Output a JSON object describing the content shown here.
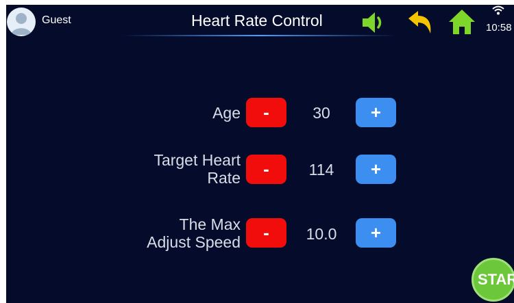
{
  "header": {
    "user_name": "Guest",
    "title": "Heart Rate Control",
    "time": "10:58",
    "icons": {
      "avatar": "user-avatar-icon",
      "sound": "speaker-icon",
      "back": "back-arrow-icon",
      "home": "home-icon",
      "wifi": "wifi-icon"
    }
  },
  "settings": [
    {
      "label_lines": [
        "Age"
      ],
      "value": "30",
      "minus_label": "-",
      "plus_label": "+"
    },
    {
      "label_lines": [
        "Target Heart",
        "Rate"
      ],
      "value": "114",
      "minus_label": "-",
      "plus_label": "+"
    },
    {
      "label_lines": [
        "The Max",
        "Adjust Speed"
      ],
      "value": "10.0",
      "minus_label": "-",
      "plus_label": "+"
    }
  ],
  "start_label": "START",
  "colors": {
    "background": "#050c2b",
    "minus_button": "#f20d0d",
    "plus_button": "#3c8ff0",
    "start_button": "#6cc83a",
    "header_icons": "#7fd62a",
    "back_icon": "#f5c400"
  }
}
